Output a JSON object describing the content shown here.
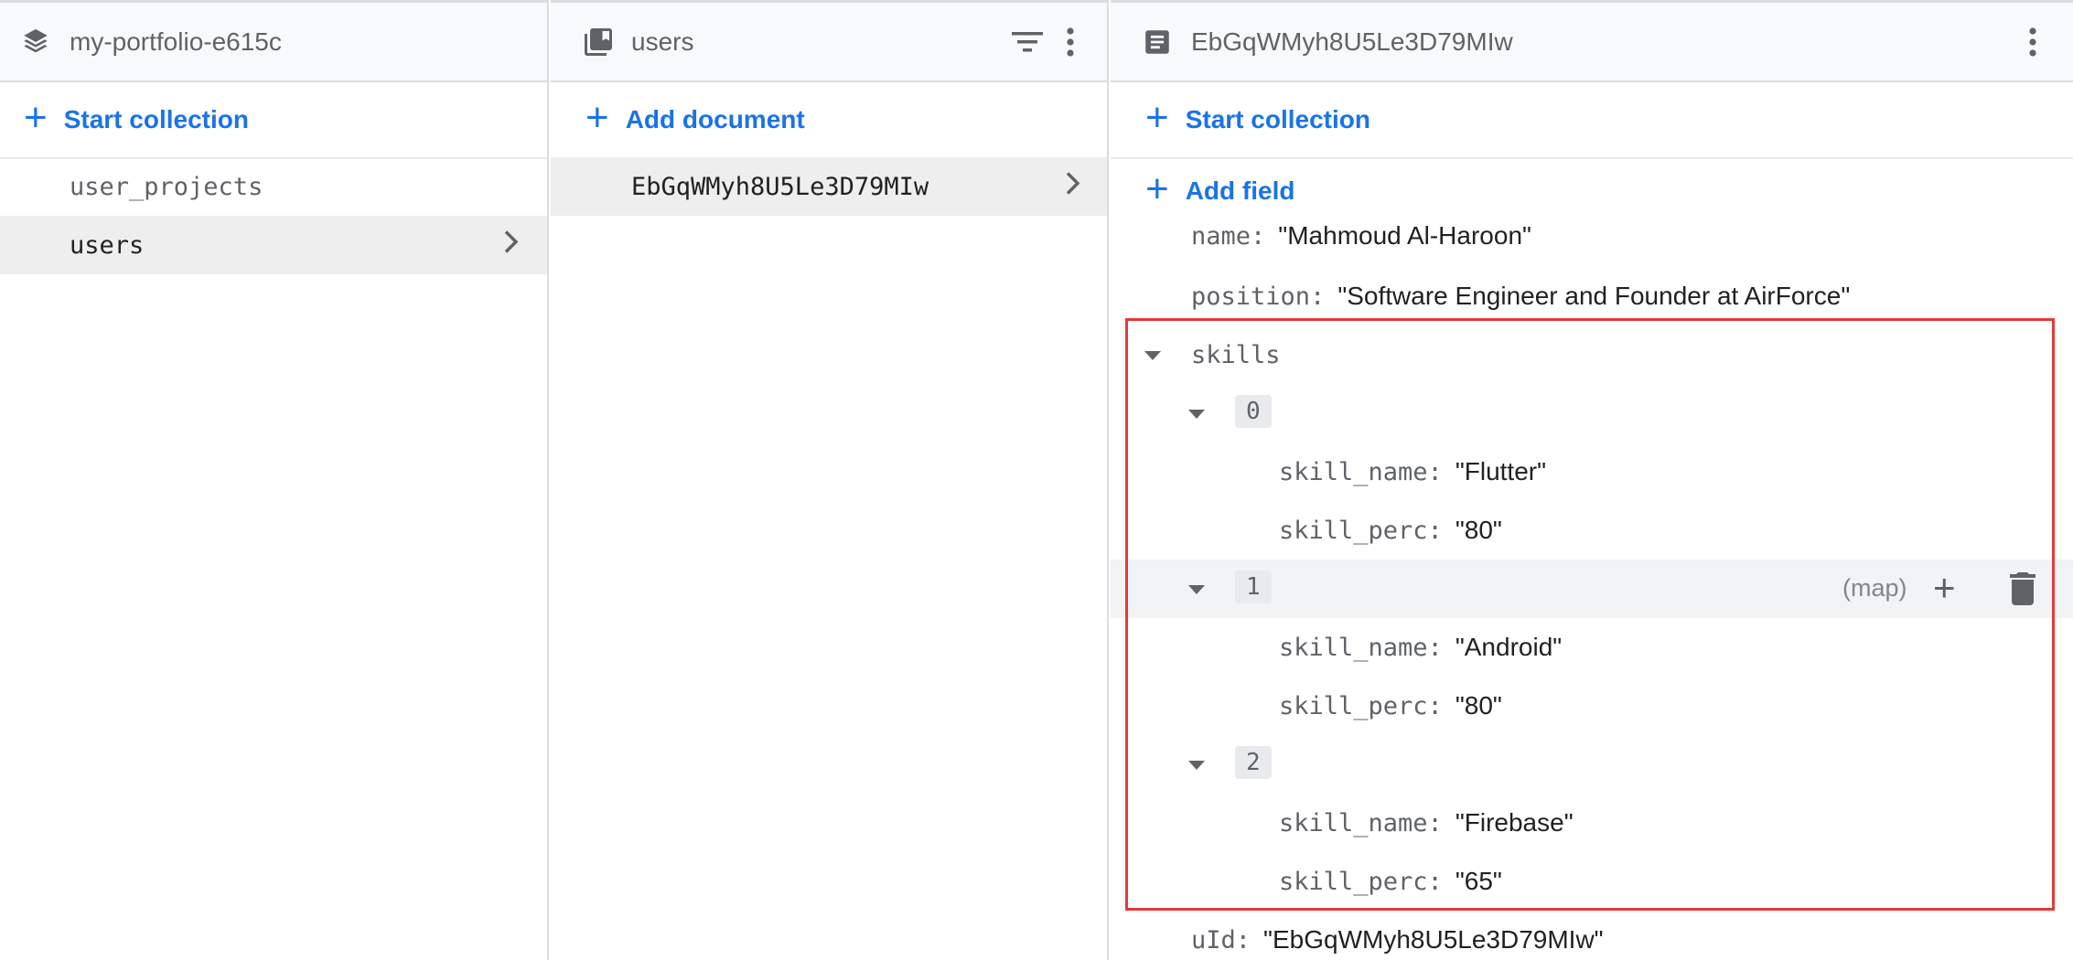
{
  "project": {
    "name": "my-portfolio-e615c",
    "icon": "firebase-stack-icon"
  },
  "collections_panel": {
    "action_label": "Start collection",
    "items": [
      {
        "label": "user_projects",
        "selected": false
      },
      {
        "label": "users",
        "selected": true
      }
    ]
  },
  "documents_panel": {
    "title": "users",
    "action_label": "Add document",
    "items": [
      {
        "label": "EbGqWMyh8U5Le3D79MIw",
        "selected": true
      }
    ]
  },
  "document_panel": {
    "title": "EbGqWMyh8U5Le3D79MIw",
    "start_collection_label": "Start collection",
    "add_field_label": "Add field",
    "fields": {
      "name": {
        "key": "name:",
        "value": "\"Mahmoud Al-Haroon\""
      },
      "position": {
        "key": "position:",
        "value": "\"Software Engineer and Founder at AirForce\""
      },
      "skills": {
        "key": "skills"
      },
      "uId": {
        "key": "uId:",
        "value": "\"EbGqWMyh8U5Le3D79MIw\""
      }
    },
    "skills": [
      {
        "index": "0",
        "skill_name_key": "skill_name:",
        "skill_name": "\"Flutter\"",
        "skill_perc_key": "skill_perc:",
        "skill_perc": "\"80\""
      },
      {
        "index": "1",
        "type_label": "(map)",
        "skill_name_key": "skill_name:",
        "skill_name": "\"Android\"",
        "skill_perc_key": "skill_perc:",
        "skill_perc": "\"80\""
      },
      {
        "index": "2",
        "skill_name_key": "skill_name:",
        "skill_name": "\"Firebase\"",
        "skill_perc_key": "skill_perc:",
        "skill_perc": "\"65\""
      }
    ]
  },
  "colors": {
    "accent": "#1a73e8",
    "highlight_border": "#e53935",
    "selected_row": "#eeeeee",
    "header_bg": "#f8f9fa"
  }
}
